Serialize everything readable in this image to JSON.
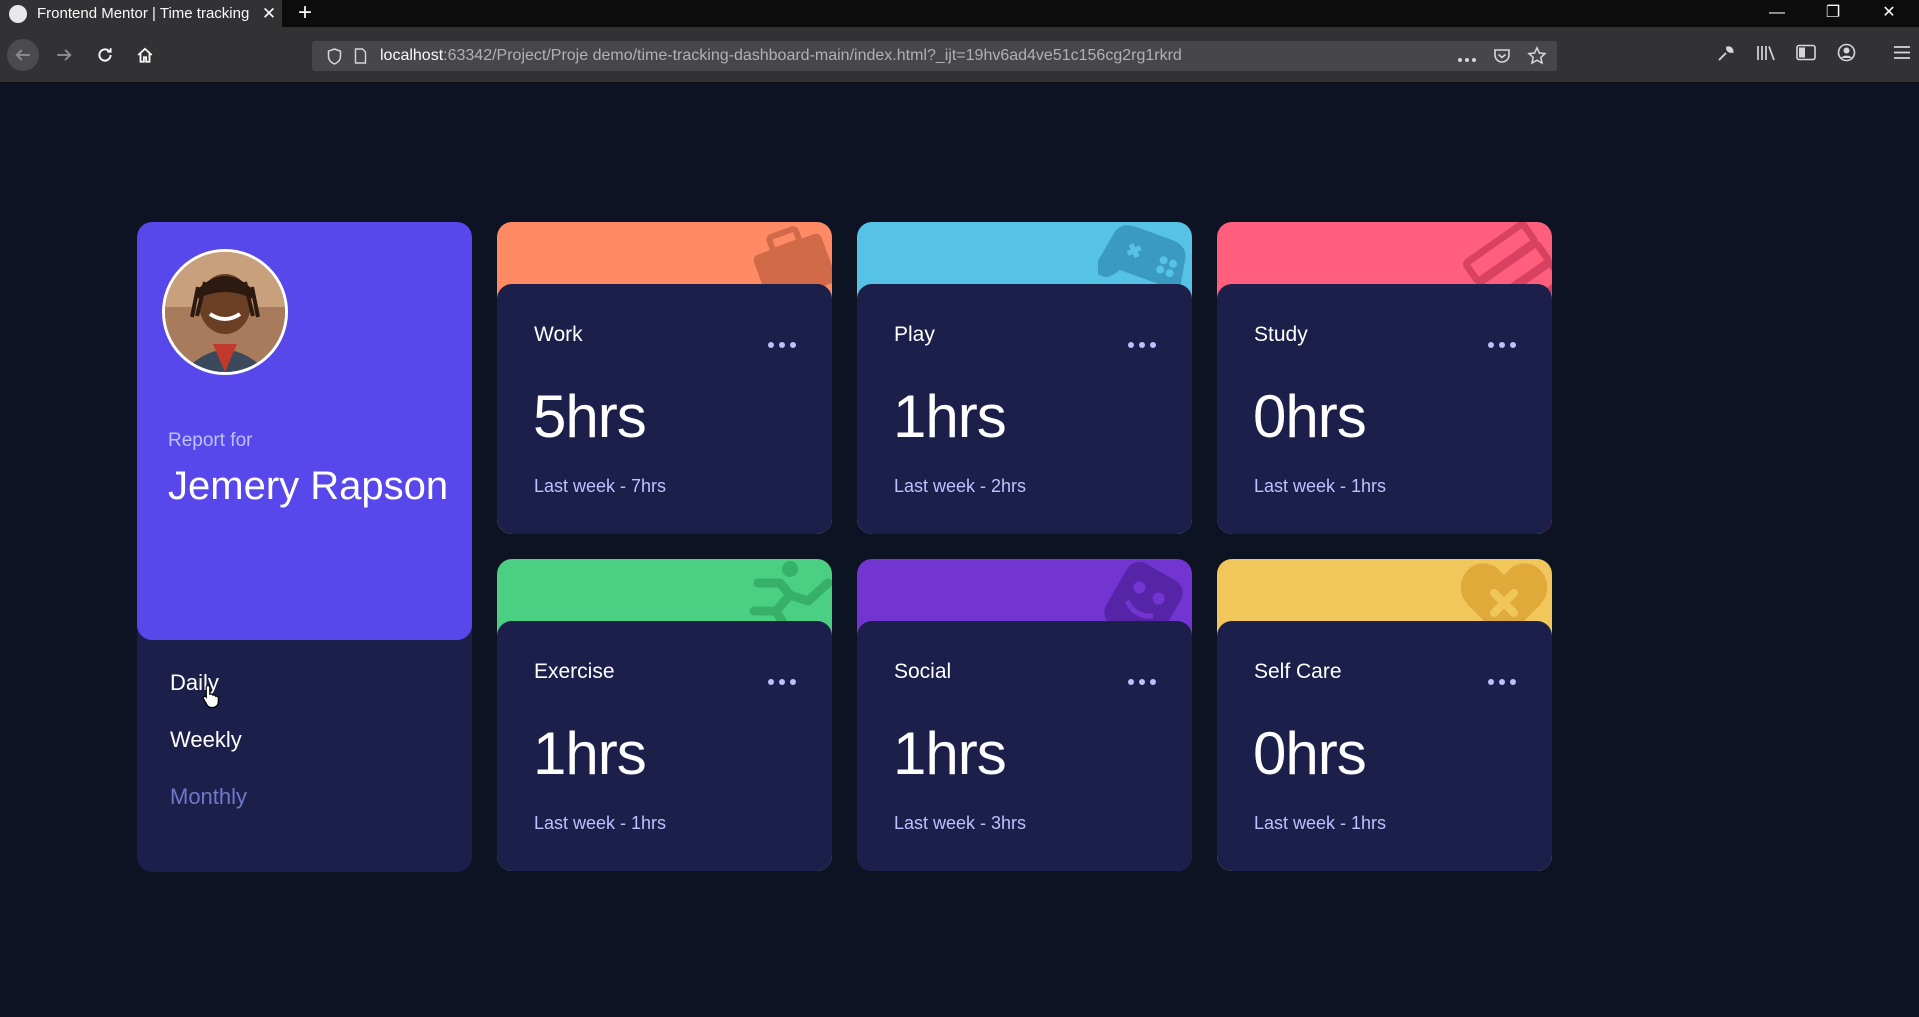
{
  "browser": {
    "tab_title": "Frontend Mentor | Time tracking dashboard",
    "tab_close": "✕",
    "new_tab": "+",
    "url_host": "localhost",
    "url_rest": ":63342/Project/Proje demo/time-tracking-dashboard-main/index.html?_ijt=19hv6ad4ve51c156cg2rg1rkrd",
    "window_controls": {
      "minimize": "—",
      "restore": "❐",
      "close": "✕"
    }
  },
  "profile": {
    "report_for": "Report for",
    "name": "Jemery Rapson",
    "periods": [
      {
        "label": "Daily",
        "state": "active"
      },
      {
        "label": "Weekly",
        "state": "hover"
      },
      {
        "label": "Monthly",
        "state": "inactive"
      }
    ]
  },
  "cards": [
    {
      "title": "Work",
      "current": "5hrs",
      "previous": "Last week - 7hrs",
      "color": "#ff8b64",
      "icon": "briefcase-icon"
    },
    {
      "title": "Play",
      "current": "1hrs",
      "previous": "Last week - 2hrs",
      "color": "#56c2e6",
      "icon": "gamepad-icon"
    },
    {
      "title": "Study",
      "current": "0hrs",
      "previous": "Last week - 1hrs",
      "color": "#ff5e7d",
      "icon": "books-icon"
    },
    {
      "title": "Exercise",
      "current": "1hrs",
      "previous": "Last week - 1hrs",
      "color": "#4bcf82",
      "icon": "running-icon"
    },
    {
      "title": "Social",
      "current": "1hrs",
      "previous": "Last week - 3hrs",
      "color": "#7235d1",
      "icon": "social-icon"
    },
    {
      "title": "Self Care",
      "current": "0hrs",
      "previous": "Last week - 1hrs",
      "color": "#f1c75b",
      "icon": "heart-icon"
    }
  ],
  "colors": {
    "page_bg": "#0e1323",
    "card_bg": "#1c1f4a",
    "profile_accent": "#5847eb",
    "pale_blue": "#bdc1ff",
    "desaturated_blue": "#7078c9"
  }
}
